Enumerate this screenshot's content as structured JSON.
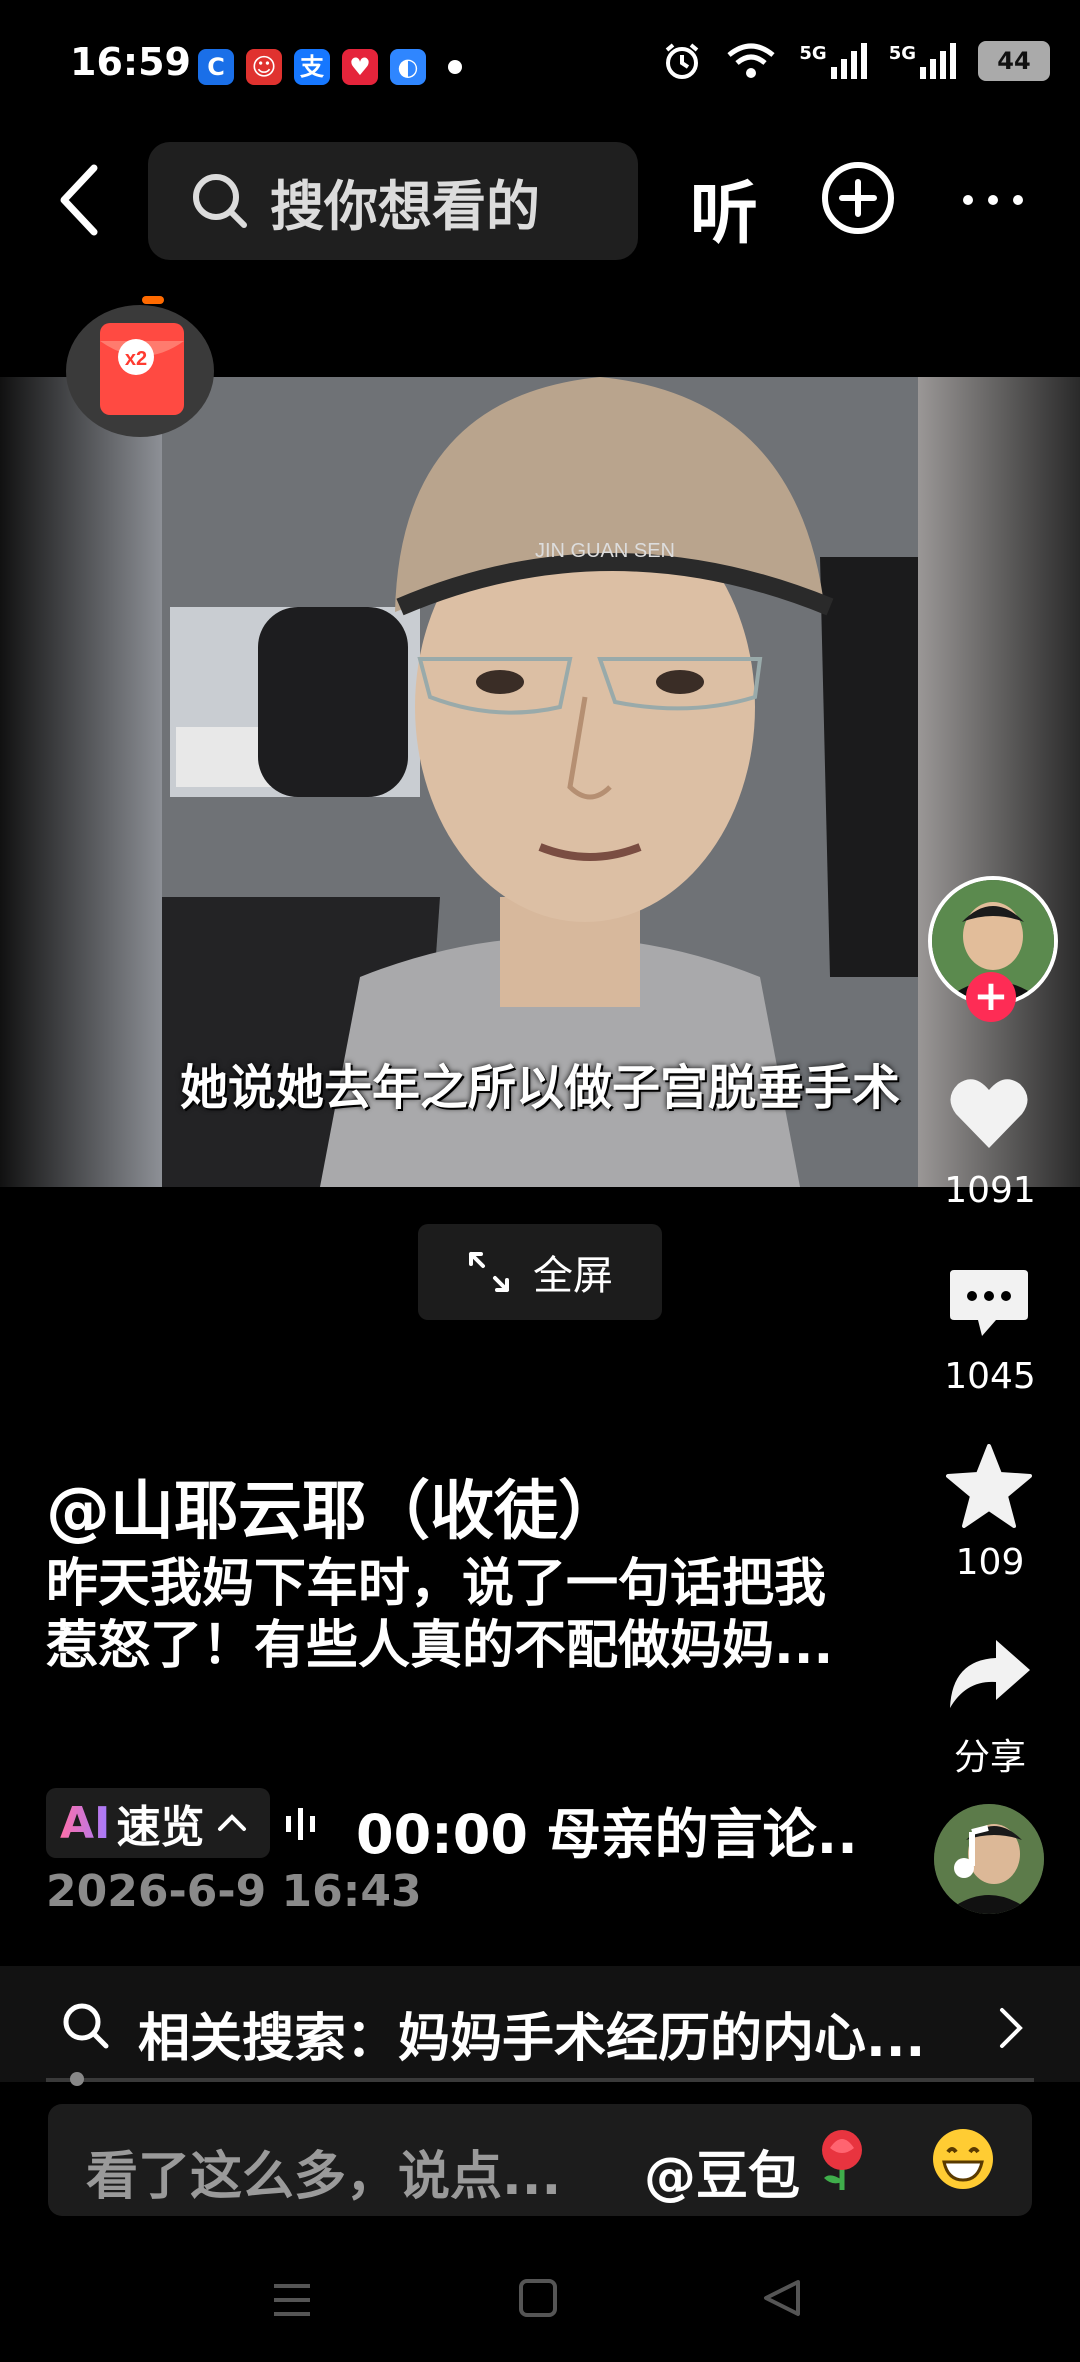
{
  "status_bar": {
    "time": "16:59",
    "app_icons": [
      "app-icon-blue-c",
      "app-icon-red-cartoon",
      "app-icon-alipay",
      "app-icon-red-heart",
      "app-icon-blue-browser"
    ],
    "net_1": "5G",
    "net_2": "5G",
    "battery": "44"
  },
  "top_nav": {
    "search_placeholder": "搜你想看的",
    "listen_label": "听"
  },
  "red_packet": {
    "multiplier": "x2"
  },
  "video": {
    "subtitle": "她说她去年之所以做子宫脱垂手术",
    "cap_text": "JIN GUAN SEN"
  },
  "fullscreen_label": "全屏",
  "actions": {
    "likes": "1091",
    "comments": "1045",
    "favorites": "109",
    "share_label": "分享"
  },
  "post": {
    "author": "@山耶云耶（收徒）",
    "caption": "昨天我妈下车时，说了一句话把我惹怒了！有些人真的不配做妈妈...",
    "ai_mark": "AI",
    "ai_label": "速览",
    "chapter": "00:00 母亲的言论..",
    "date": "2026-6-9 16:43"
  },
  "related_search": "相关搜索：妈妈手术经历的内心...",
  "comment": {
    "placeholder": "看了这么多，说点...",
    "doubao": "@豆包"
  },
  "colors": {
    "background": "#000000",
    "accent_red": "#fe2c55",
    "muted_text": "#8a8a8a"
  }
}
